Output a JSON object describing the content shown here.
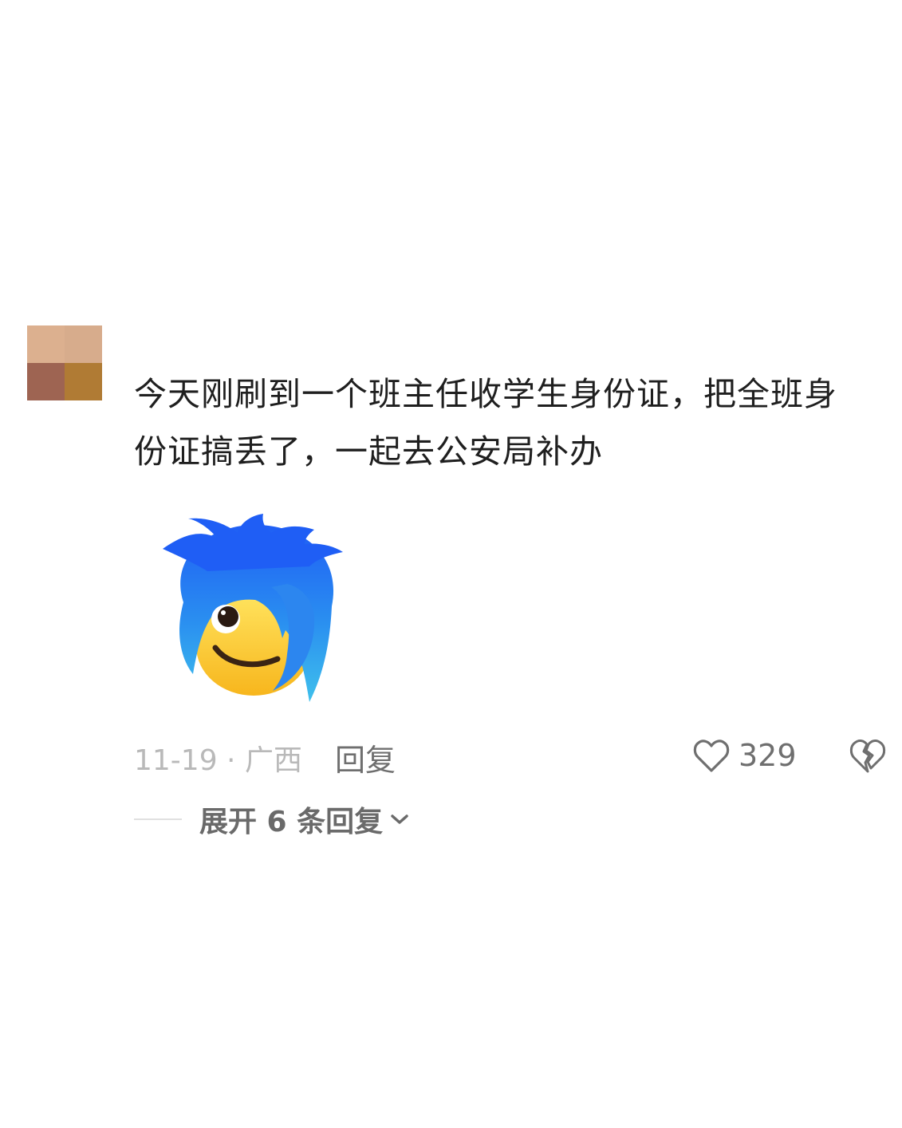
{
  "comment": {
    "avatar_colors": [
      "#dcb08f",
      "#d7ac8c",
      "#9e6452",
      "#b07b34"
    ],
    "text": "今天刚刷到一个班主任收学生身份证，把全班身份证搞丢了，一起去公安局补办",
    "sticker": "blue-haired-smirk-emoji",
    "date_location": "11-19 · 广西",
    "reply_label": "回复",
    "like_icon": "heart-outline-icon",
    "like_count": "329",
    "dislike_icon": "broken-heart-icon",
    "expand_label": "展开 6 条回复",
    "expand_icon": "chevron-down-icon"
  }
}
